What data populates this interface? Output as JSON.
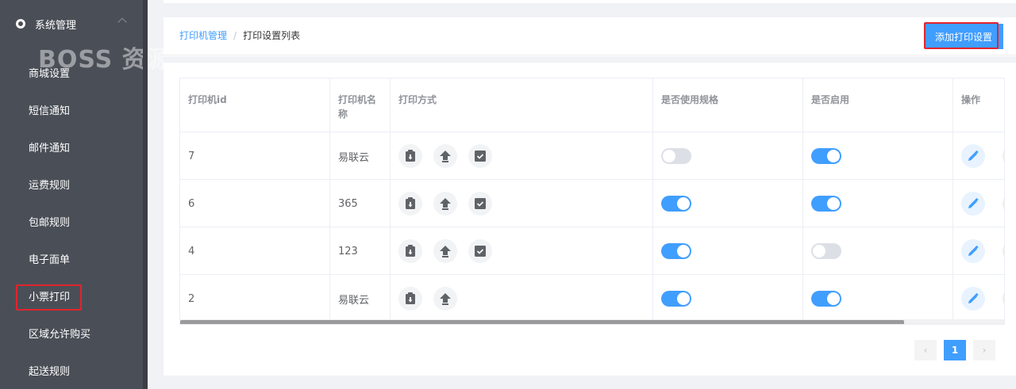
{
  "sidebar": {
    "group_title": "系统管理",
    "watermark": "BOSS 资源",
    "items": [
      {
        "label": "商城设置"
      },
      {
        "label": "短信通知"
      },
      {
        "label": "邮件通知"
      },
      {
        "label": "运费规则"
      },
      {
        "label": "包邮规则"
      },
      {
        "label": "电子面单"
      },
      {
        "label": "小票打印",
        "active": true
      },
      {
        "label": "区域允许购买"
      },
      {
        "label": "起送规则"
      }
    ]
  },
  "breadcrumb": {
    "parent": "打印机管理",
    "separator": "/",
    "current": "打印设置列表"
  },
  "toolbar": {
    "add_label": "添加打印设置"
  },
  "table": {
    "headers": [
      "打印机id",
      "打印机名称",
      "打印方式",
      "是否使用规格",
      "是否启用",
      "操作"
    ],
    "rows": [
      {
        "id": "7",
        "name": "易联云",
        "methods": [
          "clipboard-icon",
          "upload-icon",
          "inbox-icon"
        ],
        "use_spec": false,
        "enabled": true
      },
      {
        "id": "6",
        "name": "365",
        "methods": [
          "clipboard-icon",
          "upload-icon",
          "inbox-icon"
        ],
        "use_spec": true,
        "enabled": true
      },
      {
        "id": "4",
        "name": "123",
        "methods": [
          "clipboard-icon",
          "upload-icon",
          "inbox-icon"
        ],
        "use_spec": true,
        "enabled": false
      },
      {
        "id": "2",
        "name": "易联云",
        "methods": [
          "clipboard-icon",
          "upload-icon"
        ],
        "use_spec": true,
        "enabled": true
      }
    ]
  },
  "pagination": {
    "prev": "‹",
    "current": "1",
    "next": "›"
  },
  "colors": {
    "accent": "#409eff",
    "highlight": "#e3232e",
    "sidebar": "#4a4f57"
  }
}
